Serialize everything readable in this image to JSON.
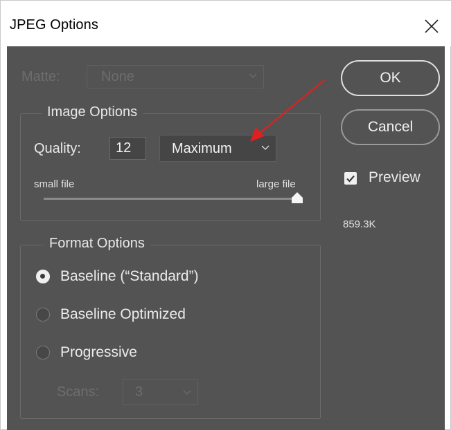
{
  "window": {
    "title": "JPEG Options"
  },
  "matte": {
    "label": "Matte:",
    "value": "None",
    "enabled": false
  },
  "image_options": {
    "legend": "Image Options",
    "quality_label": "Quality:",
    "quality_value": "12",
    "quality_preset": "Maximum",
    "slider_min_label": "small file",
    "slider_max_label": "large file",
    "slider_level": 1.0
  },
  "format_options": {
    "legend": "Format Options",
    "options": [
      {
        "label": "Baseline (“Standard”)",
        "selected": true
      },
      {
        "label": "Baseline Optimized",
        "selected": false
      },
      {
        "label": "Progressive",
        "selected": false
      }
    ],
    "scans_label": "Scans:",
    "scans_value": "3",
    "scans_enabled": false
  },
  "buttons": {
    "ok": "OK",
    "cancel": "Cancel"
  },
  "preview": {
    "label": "Preview",
    "checked": true
  },
  "file_size": "859.3K",
  "colors": {
    "dialog_bg": "#535353",
    "text": "#e6e6e6",
    "disabled_text": "#6d6d6d",
    "annotation_arrow": "#e02020"
  }
}
